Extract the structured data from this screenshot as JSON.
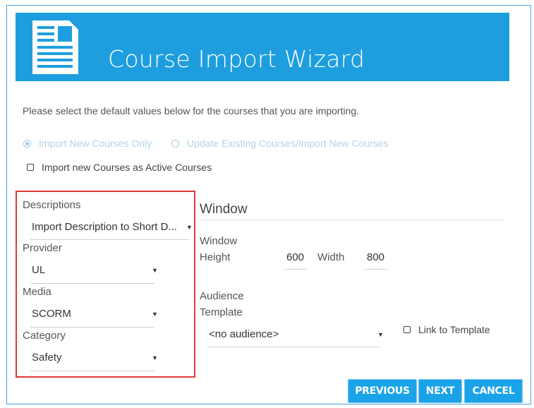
{
  "banner": {
    "title": "Course Import Wizard"
  },
  "intro_text": "Please select the default values below for the courses that you are importing.",
  "import_mode": {
    "options": [
      "Import New Courses Only",
      "Update Existing Courses/Import New Courses"
    ],
    "selected": "Import New Courses Only"
  },
  "active_courses": {
    "label": "Import new Courses as Active Courses",
    "checked": false
  },
  "descriptions": {
    "label": "Descriptions",
    "value": "Import Description to Short D..."
  },
  "provider": {
    "label": "Provider",
    "value": "UL"
  },
  "media": {
    "label": "Media",
    "value": "SCORM"
  },
  "category": {
    "label": "Category",
    "value": "Safety"
  },
  "window": {
    "heading": "Window",
    "label_line1": "Window",
    "label_line2": "Height",
    "height": "600",
    "width_label": "Width",
    "width": "800"
  },
  "audience": {
    "label_line1": "Audience",
    "label_line2": "Template",
    "value": "<no audience>",
    "link_label": "Link to Template",
    "link_checked": false
  },
  "buttons": {
    "previous": "PREVIOUS",
    "next": "NEXT",
    "cancel": "CANCEL"
  },
  "colors": {
    "banner": "#1e9ede",
    "button": "#1aa3e8",
    "highlight": "#e0383b"
  }
}
